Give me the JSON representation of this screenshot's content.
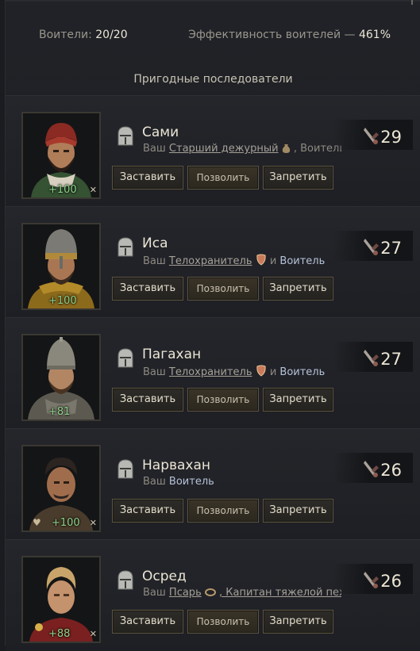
{
  "summary": {
    "warriors_label": "Воители:",
    "warriors_value": "20/20",
    "efficiency_label": "Эффективность воителей —",
    "efficiency_value": "461%"
  },
  "section_title": "Пригодные последователи",
  "buttons": {
    "force": "Заставить",
    "allow": "Позволить",
    "forbid": "Запретить"
  },
  "followers": [
    {
      "name": "Сами",
      "role_prefix": "Ваш",
      "role_main": "Старший дежурный",
      "role_rest": ", Воитель и ...",
      "prowess": "29",
      "opinion": "+100",
      "headwear": "turban",
      "colors": {
        "head": "#8a2a22",
        "robe": "#3a5a3a"
      }
    },
    {
      "name": "Иса",
      "role_prefix": "Ваш",
      "role_main": "Телохранитель",
      "role_and": "и",
      "role_tail": "Воитель",
      "prowess": "27",
      "opinion": "+100",
      "headwear": "helmet",
      "colors": {
        "head": "#7b7a74",
        "robe": "#8c6a1c"
      }
    },
    {
      "name": "Пагахан",
      "role_prefix": "Ваш",
      "role_main": "Телохранитель",
      "role_and": "и",
      "role_tail": "Воитель",
      "prowess": "27",
      "opinion": "+81",
      "headwear": "helmet",
      "colors": {
        "head": "#8a877c",
        "robe": "#5c5a50"
      }
    },
    {
      "name": "Нарвахан",
      "role_prefix": "Ваш",
      "role_tail": "Воитель",
      "prowess": "26",
      "opinion": "+100",
      "headwear": "none",
      "colors": {
        "head": "#2b2420",
        "robe": "#4a3c2c"
      }
    },
    {
      "name": "Осред",
      "role_prefix": "Ваш",
      "role_main": "Псарь",
      "role_rest": ", Капитан тяжелой пехот ...",
      "prowess": "26",
      "opinion": "+88",
      "headwear": "none",
      "colors": {
        "head": "#c9a46a",
        "robe": "#7a2020"
      }
    }
  ]
}
